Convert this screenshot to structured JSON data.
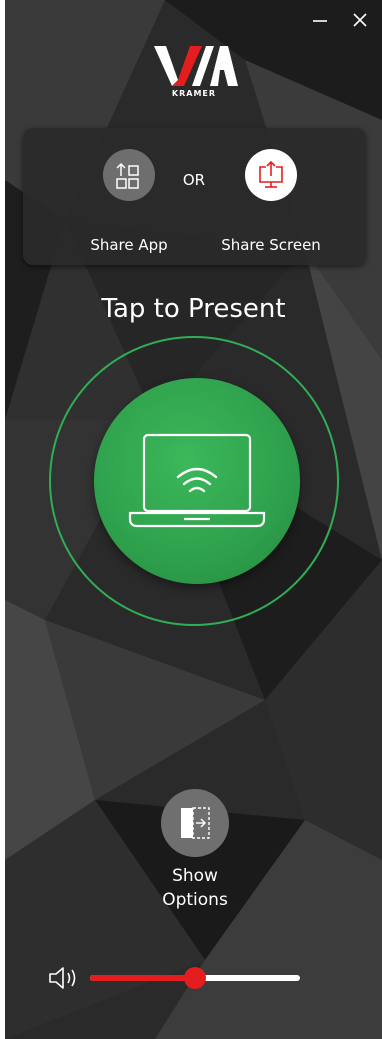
{
  "app": {
    "logo_text": "VIA",
    "logo_sub": "KRAMER"
  },
  "share": {
    "app_label": "Share App",
    "or_label": "OR",
    "screen_label": "Share Screen"
  },
  "present": {
    "title": "Tap to Present"
  },
  "options": {
    "line1": "Show",
    "line2": "Options"
  },
  "volume": {
    "level": 0.5
  },
  "colors": {
    "accent_green": "#2fae55",
    "accent_red": "#e41e1e",
    "background": "#262626"
  },
  "icons": {
    "minimize": "minimize-icon",
    "close": "close-icon",
    "share_app": "share-app-icon",
    "share_screen": "share-screen-icon",
    "present": "laptop-wifi-icon",
    "options": "panel-expand-icon",
    "volume": "speaker-icon"
  }
}
